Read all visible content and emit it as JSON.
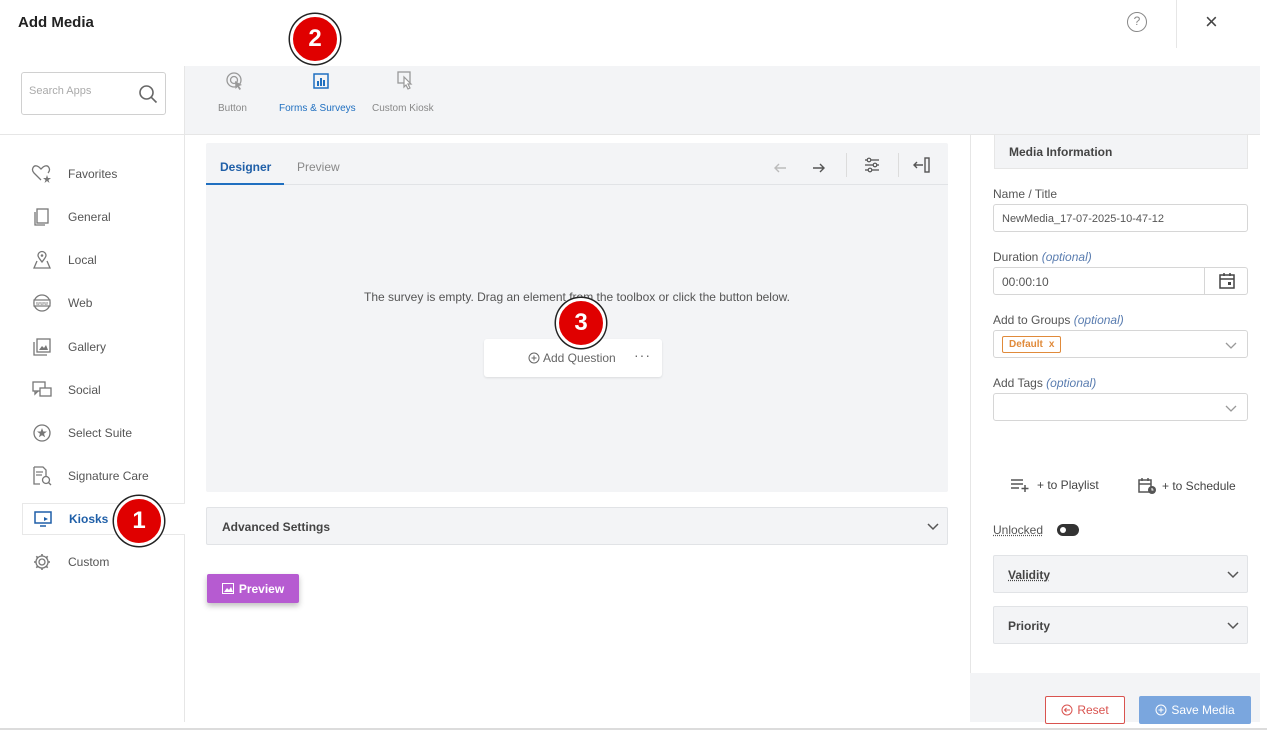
{
  "header": {
    "title": "Add Media",
    "help_label": "?",
    "close_label": "×"
  },
  "search": {
    "placeholder": "Search Apps"
  },
  "sidebar": {
    "items": [
      {
        "label": "Favorites",
        "icon": "heart-star-icon"
      },
      {
        "label": "General",
        "icon": "copy-icon"
      },
      {
        "label": "Local",
        "icon": "map-pin-icon"
      },
      {
        "label": "Web",
        "icon": "globe-icon"
      },
      {
        "label": "Gallery",
        "icon": "gallery-icon"
      },
      {
        "label": "Social",
        "icon": "chat-icon"
      },
      {
        "label": "Select Suite",
        "icon": "star-circle-icon"
      },
      {
        "label": "Signature Care",
        "icon": "document-search-icon"
      },
      {
        "label": "Kiosks",
        "icon": "monitor-icon",
        "active": true
      },
      {
        "label": "Custom",
        "icon": "gear-icon"
      }
    ]
  },
  "toolbar": {
    "tools": [
      {
        "label": "Button",
        "icon": "pointer-click-icon"
      },
      {
        "label": "Forms & Surveys",
        "icon": "bar-chart-icon",
        "active": true
      },
      {
        "label": "Custom Kiosk",
        "icon": "kiosk-touch-icon"
      }
    ]
  },
  "designer": {
    "tabs": [
      "Designer",
      "Preview"
    ],
    "empty_message": "The survey is empty. Drag an element from the toolbox or click the button below.",
    "add_question": "Add Question",
    "more": "···"
  },
  "advanced": {
    "label": "Advanced Settings"
  },
  "preview_button": "Preview",
  "media_info": {
    "heading": "Media Information",
    "name_label": "Name / Title",
    "name_value": "NewMedia_17-07-2025-10-47-12",
    "duration_label": "Duration",
    "duration_value": "00:00:10",
    "groups_label": "Add to Groups",
    "group_tag": "Default",
    "group_tag_remove": "x",
    "tags_label": "Add Tags",
    "optional": "(optional)",
    "to_playlist": "+ to Playlist",
    "to_schedule": "+ to Schedule",
    "unlocked": "Unlocked",
    "validity": "Validity",
    "priority": "Priority"
  },
  "footer": {
    "reset": "Reset",
    "save": "Save Media"
  },
  "markers": [
    "1",
    "2",
    "3"
  ],
  "colors": {
    "accent": "#1f6fc0",
    "preview": "#b65bd1",
    "reset": "#d9534f",
    "save": "#7aa6de",
    "tag": "#e08a3a",
    "marker": "#e00000"
  }
}
